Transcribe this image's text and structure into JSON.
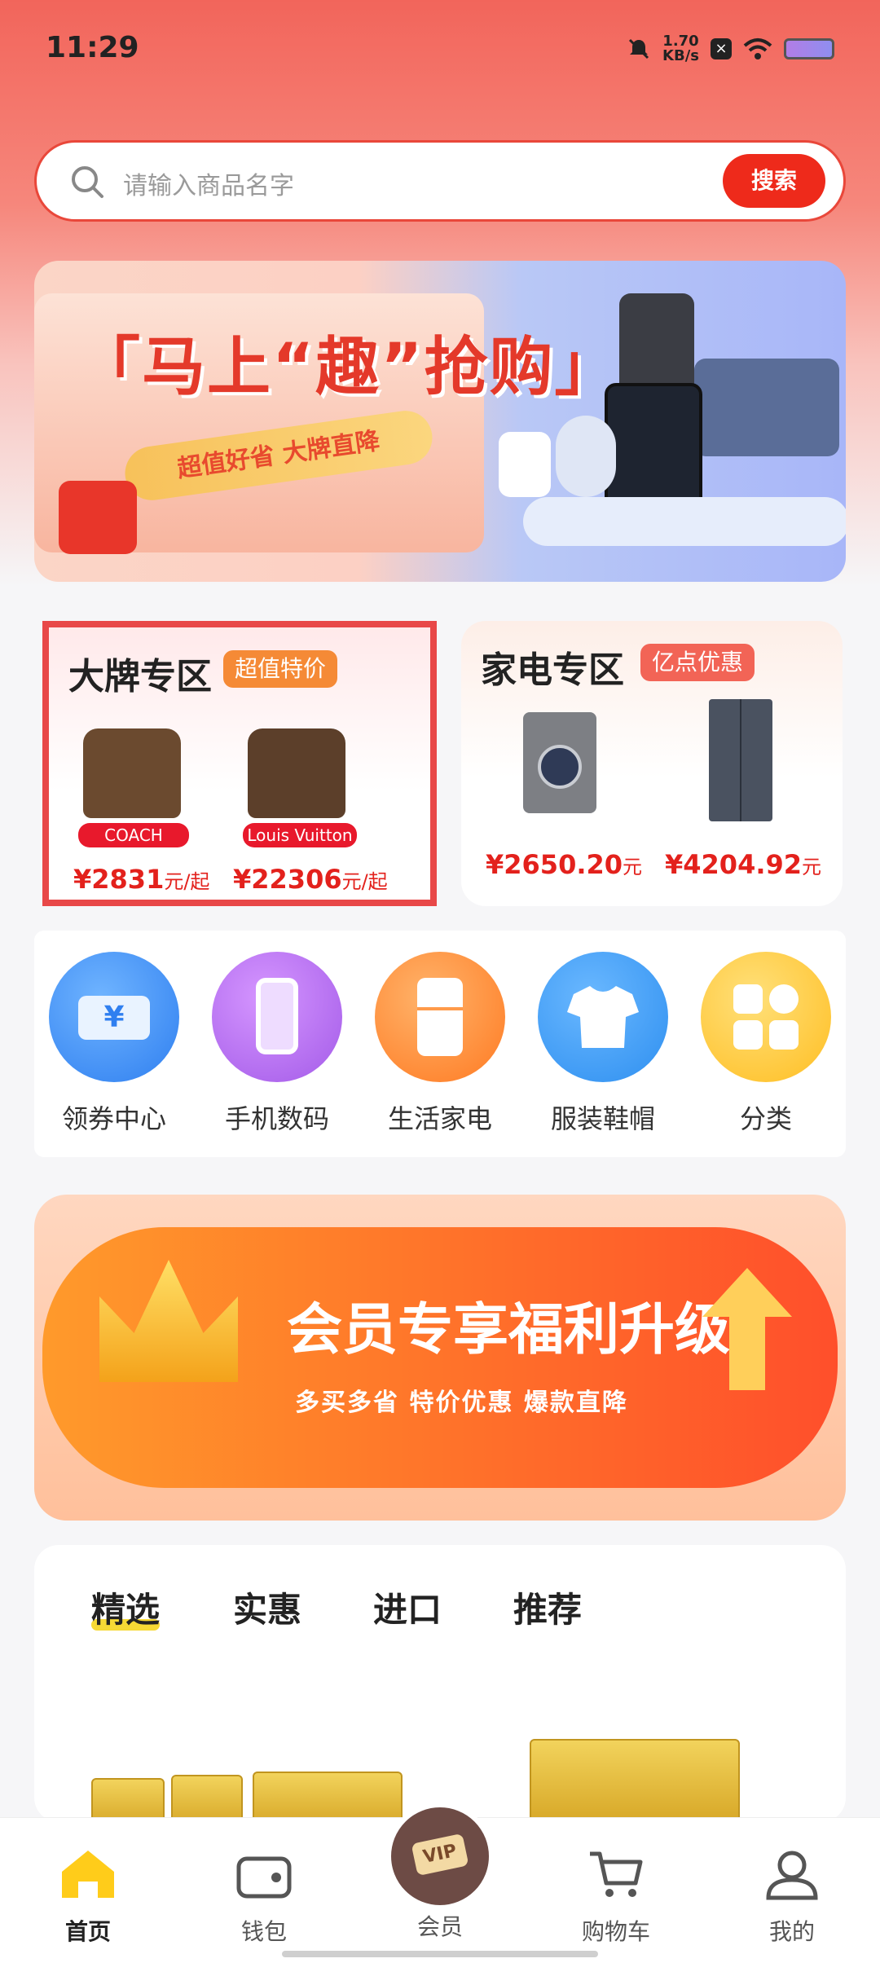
{
  "status_bar": {
    "time": "11:29",
    "speed_value": "1.70",
    "speed_unit": "KB/s"
  },
  "search": {
    "placeholder": "请输入商品名字",
    "button_label": "搜索"
  },
  "banner_top": {
    "title": "「马上“趣”抢购」",
    "ribbon": "超值好省  大牌直降"
  },
  "brand_zone": {
    "title": "大牌专区",
    "tag": "超值特价",
    "items": [
      {
        "brand": "COACH",
        "price": "¥2831",
        "unit": "元/起"
      },
      {
        "brand": "Louis Vuitton",
        "price": "¥22306",
        "unit": "元/起"
      }
    ]
  },
  "appliance_zone": {
    "title": "家电专区",
    "tag": "亿点优惠",
    "items": [
      {
        "price": "¥2650.20",
        "unit": "元"
      },
      {
        "price": "¥4204.92",
        "unit": "元"
      }
    ]
  },
  "categories": [
    {
      "label": "领券中心",
      "icon": "coupon-icon",
      "color": "#3a8df0"
    },
    {
      "label": "手机数码",
      "icon": "phone-icon",
      "color": "#b86bf0"
    },
    {
      "label": "生活家电",
      "icon": "fridge-icon",
      "color": "#ff8a2d"
    },
    {
      "label": "服装鞋帽",
      "icon": "tshirt-icon",
      "color": "#3a9cf2"
    },
    {
      "label": "分类",
      "icon": "grid-icon",
      "color": "#ffc02d"
    }
  ],
  "banner_member": {
    "title": "会员专享福利升级",
    "subtitle": "多买多省 特价优惠 爆款直降"
  },
  "tabs": [
    "精选",
    "实惠",
    "进口",
    "推荐"
  ],
  "bottom_nav": [
    {
      "label": "首页",
      "icon": "home-icon",
      "active": true
    },
    {
      "label": "钱包",
      "icon": "wallet-icon"
    },
    {
      "label": "会员",
      "icon": "vip-icon"
    },
    {
      "label": "购物车",
      "icon": "cart-icon"
    },
    {
      "label": "我的",
      "icon": "profile-icon"
    }
  ],
  "vip_badge": "VIP",
  "colors": {
    "accent": "#ee2a1b",
    "price": "#e3211c"
  }
}
